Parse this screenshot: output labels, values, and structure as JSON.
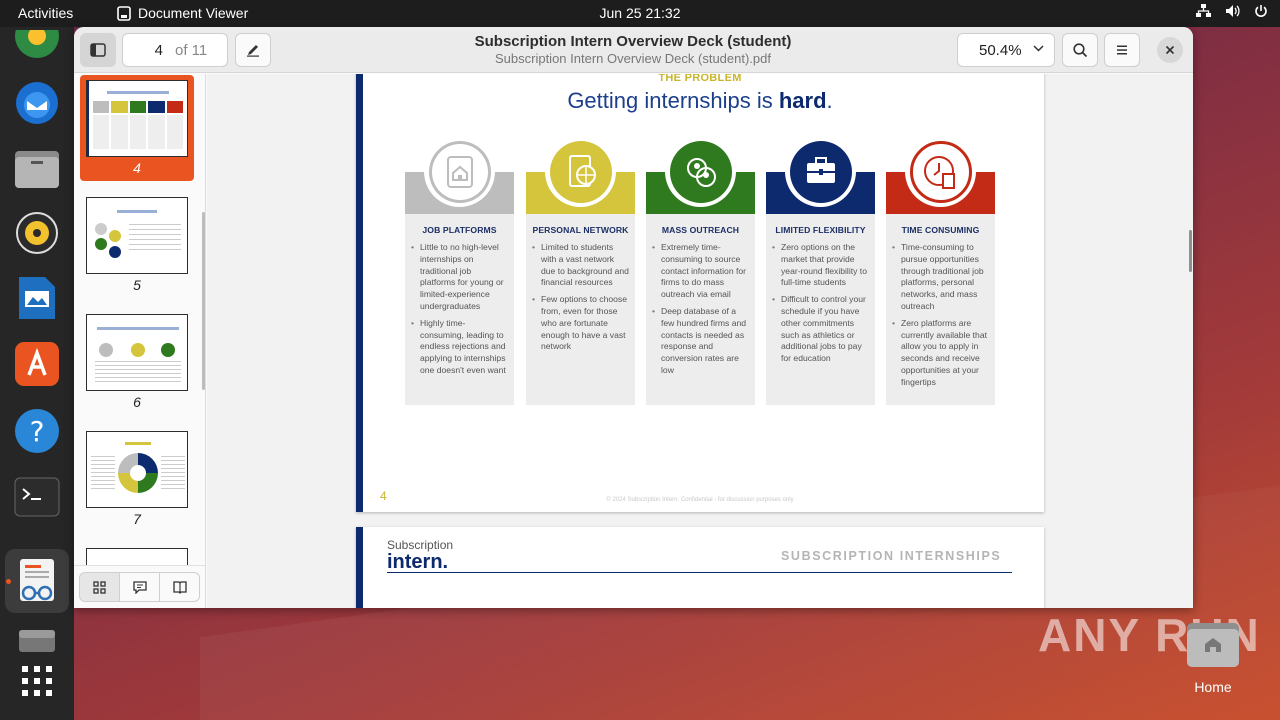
{
  "topbar": {
    "activities": "Activities",
    "app_name": "Document Viewer",
    "clock": "Jun 25  21:32"
  },
  "window": {
    "page_current": "4",
    "page_total": "of 11",
    "title": "Subscription Intern Overview Deck (student)",
    "subtitle": "Subscription Intern Overview Deck (student).pdf",
    "zoom": "50.4%"
  },
  "thumbnails": [
    {
      "num": "4",
      "selected": true
    },
    {
      "num": "5",
      "selected": false
    },
    {
      "num": "6",
      "selected": false
    },
    {
      "num": "7",
      "selected": false
    }
  ],
  "slide": {
    "kicker": "THE PROBLEM",
    "title_a": "Getting internships is ",
    "title_b": "hard",
    "title_c": ".",
    "page_num": "4",
    "footer": "© 2024 Subscription Intern. Confidential - for discussion purposes only",
    "columns": [
      {
        "color": "#bdbdbd",
        "icon": "job-platform-icon",
        "head": "JOB PLATFORMS",
        "bullets": [
          "Little to no high-level internships on traditional job platforms for young or limited-experience undergraduates",
          "Highly time-consuming, leading to endless rejections and applying to internships one doesn't even want"
        ]
      },
      {
        "color": "#d4c53c",
        "icon": "network-icon",
        "head": "PERSONAL NETWORK",
        "bullets": [
          "Limited to students with a vast network due to background and financial resources",
          "Few options to choose from, even for those who are fortunate enough to have a vast network"
        ]
      },
      {
        "color": "#2f7a1e",
        "icon": "outreach-icon",
        "head": "MASS OUTREACH",
        "bullets": [
          "Extremely time-consuming to source contact information for firms to do mass outreach via email",
          "Deep database of a few hundred firms and contacts is needed as response and conversion rates are low"
        ]
      },
      {
        "color": "#0d2a6e",
        "icon": "briefcase-icon",
        "head": "LIMITED FLEXIBILITY",
        "bullets": [
          "Zero options on the market that provide year-round flexibility to full-time students",
          "Difficult to control your schedule if you have other commitments such as athletics or additional jobs to pay for education"
        ]
      },
      {
        "color": "#c42b16",
        "icon": "clock-icon",
        "head": "TIME CONSUMING",
        "bullets": [
          "Time-consuming to pursue opportunities through traditional job platforms, personal networks, and mass outreach",
          "Zero platforms are currently available that allow you to apply in seconds and receive opportunities at your fingertips"
        ]
      }
    ]
  },
  "next_slide": {
    "logo_small": "Subscription",
    "logo_big": "intern.",
    "brand": "SUBSCRIPTION INTERNSHIPS"
  },
  "desktop": {
    "home_label": "Home",
    "watermark": "ANY RUN"
  }
}
